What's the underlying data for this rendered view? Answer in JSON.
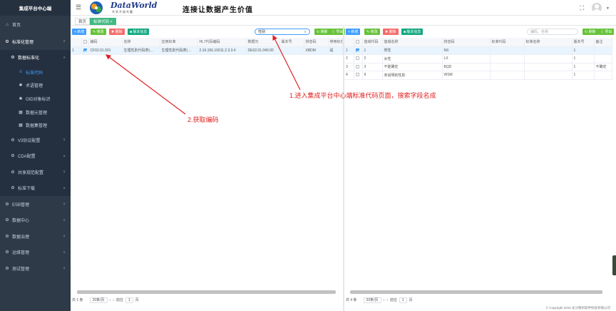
{
  "sidebar": {
    "title": "集成平台中心端",
    "items": [
      {
        "label": "首页",
        "icon": "home-icon"
      },
      {
        "label": "标准化管理",
        "icon": "gear-icon"
      },
      {
        "label": "数据标准化",
        "icon": "gear-icon"
      },
      {
        "label": "标准代码",
        "icon": "code-icon"
      },
      {
        "label": "术语管理",
        "icon": "book-icon"
      },
      {
        "label": "OID对象标识",
        "icon": "tag-icon"
      },
      {
        "label": "数据元管理",
        "icon": "grid-icon"
      },
      {
        "label": "数据集管理",
        "icon": "grid-icon"
      },
      {
        "label": "V3协议配置",
        "icon": "gear-icon"
      },
      {
        "label": "CDA配置",
        "icon": "gear-icon"
      },
      {
        "label": "共享规范配置",
        "icon": "gear-icon"
      },
      {
        "label": "标准下载",
        "icon": "download-icon"
      },
      {
        "label": "ESB管理",
        "icon": "gear-icon"
      },
      {
        "label": "数据中心",
        "icon": "gear-icon"
      },
      {
        "label": "数据治理",
        "icon": "gear-icon"
      },
      {
        "label": "运维管理",
        "icon": "gear-icon"
      },
      {
        "label": "测试管理",
        "icon": "gear-icon"
      }
    ]
  },
  "header": {
    "logo_text": "DataWorld",
    "logo_sub": "共享开放共赢",
    "slogan": "连接让数据产生价值"
  },
  "tabs": [
    {
      "label": "首页"
    },
    {
      "label": "标准代码 ×"
    }
  ],
  "left_toolbar": {
    "add": "+ 新增",
    "edit": "✎ 修改",
    "delete": "✖ 删除",
    "version": "■ 版本信息",
    "search_value": "性别",
    "refresh": "↻ 刷新",
    "export": "⇩ 导出"
  },
  "left_table": {
    "columns": [
      "编码",
      "名称",
      "应用标准",
      "HL7代码编码",
      "数据元",
      "版本号",
      "拼音码",
      "停用标志"
    ],
    "rows": [
      {
        "no": "1",
        "code": "CF02.01.001",
        "name": "生理性别代码表(…",
        "standard": "生理性别代码表(…",
        "hl7": "2.16.156.10011.2.3.3.4",
        "element": "DE02.01.040.00",
        "version": "",
        "pinyin": "XBDM",
        "flag": "是"
      }
    ]
  },
  "right_toolbar": {
    "add": "+ 新增",
    "edit": "✎ 修改",
    "delete": "✖ 删除",
    "version": "■ 版本信息",
    "search_placeholder": "编码、名称",
    "refresh": "↻ 刷新",
    "export": "⇩ 导出"
  },
  "right_table": {
    "columns": [
      "值域代码",
      "值域名称",
      "拼音码",
      "标准代码",
      "标准名称",
      "版本号",
      "备注"
    ],
    "rows": [
      {
        "no": "1",
        "code": "1",
        "name": "男性",
        "pinyin": "NX",
        "std_code": "",
        "std_name": "",
        "version": "1",
        "note": ""
      },
      {
        "no": "2",
        "code": "2",
        "name": "女性",
        "pinyin": "LX",
        "std_code": "",
        "std_name": "",
        "version": "1",
        "note": ""
      },
      {
        "no": "3",
        "code": "3",
        "name": "不能确定",
        "pinyin": "BQD",
        "std_code": "",
        "std_name": "",
        "version": "1",
        "note": "不确定"
      },
      {
        "no": "4",
        "code": "9",
        "name": "未说明的性别",
        "pinyin": "WSM",
        "std_code": "",
        "std_name": "",
        "version": "1",
        "note": ""
      }
    ]
  },
  "left_pager": {
    "total": "共 1 条",
    "size": "20条/页",
    "goto": "前往",
    "page": "1",
    "unit": "页"
  },
  "right_pager": {
    "total": "共 4 条",
    "size": "20条/页",
    "goto": "前往",
    "page": "1",
    "unit": "页"
  },
  "copyright": "© Copyright 2016 长沙德讯软件科技有限公司",
  "annotations": {
    "step1": "1.进入集成平台中心端标准代码页面，搜索字段名成",
    "step2": "2.获取编码"
  },
  "colors": {
    "sidebar": "#2e3a48",
    "accent": "#409eff",
    "annotation": "#e02020"
  }
}
